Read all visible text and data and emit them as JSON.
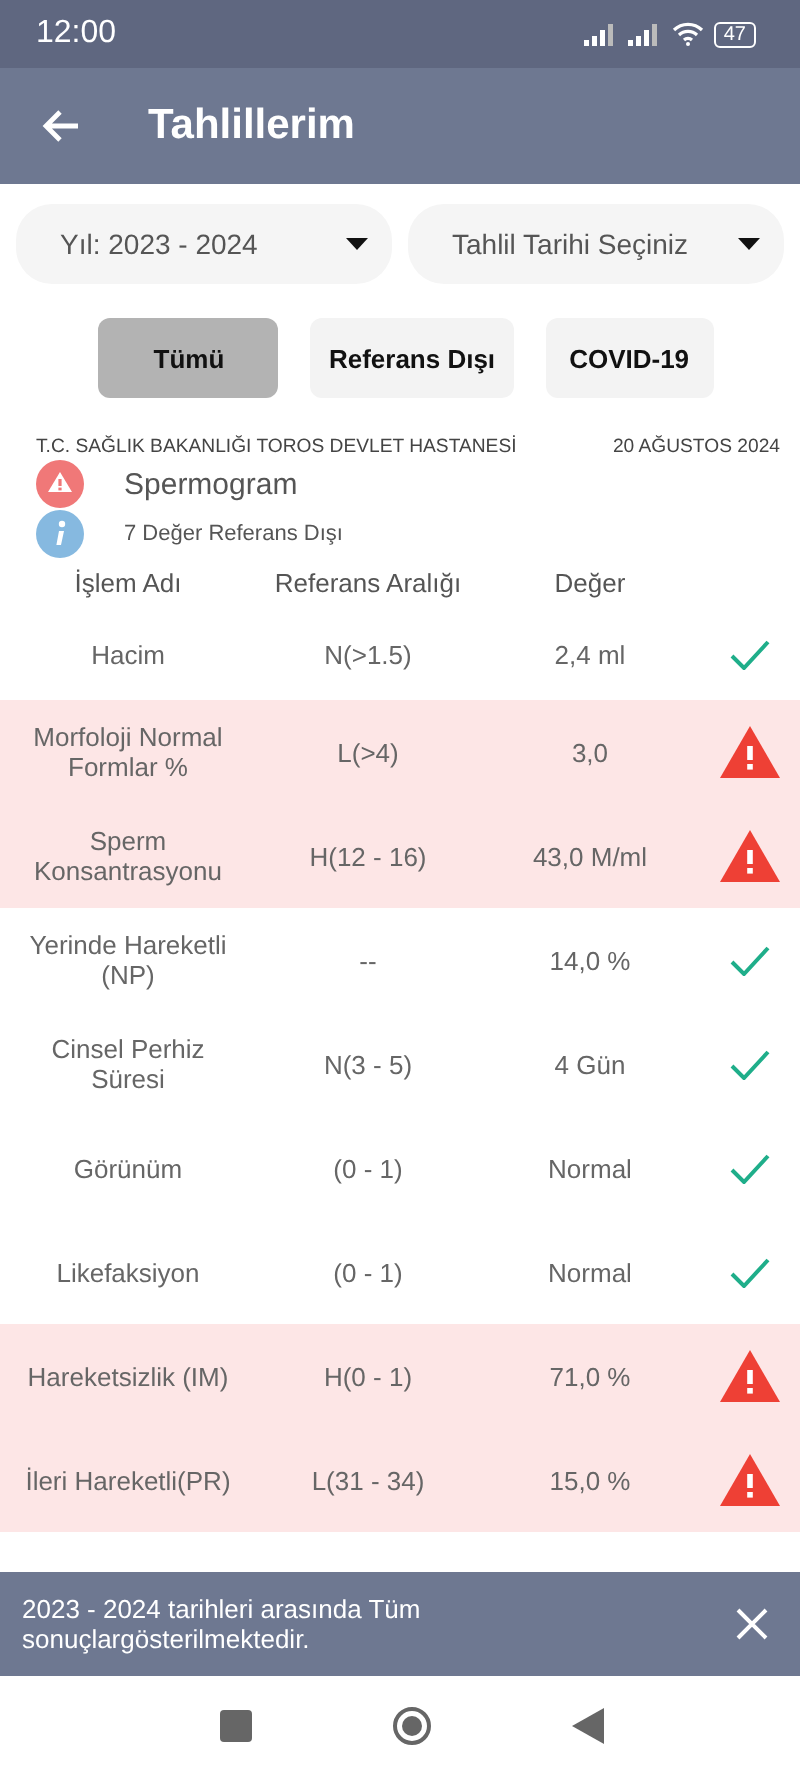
{
  "status_bar": {
    "time": "12:00",
    "battery": "47"
  },
  "app_bar": {
    "title": "Tahlillerim"
  },
  "dropdowns": [
    {
      "value": "Yıl: 2023 - 2024"
    },
    {
      "value": "Tahlil Tarihi Seçiniz"
    }
  ],
  "filters": [
    {
      "label": "Tümü",
      "selected": true
    },
    {
      "label": "Referans Dışı",
      "selected": false
    },
    {
      "label": "COVID-19",
      "selected": false
    }
  ],
  "report": {
    "hospital": "T.C. SAĞLIK BAKANLIĞI TOROS DEVLET HASTANESİ",
    "date": "20 AĞUSTOS 2024",
    "test_name": "Spermogram",
    "note": "7 Değer Referans Dışı"
  },
  "table": {
    "columns": [
      "İşlem Adı",
      "Referans Aralığı",
      "Değer"
    ],
    "rows": [
      {
        "name": "Hacim",
        "range": "N(>1.5)",
        "value": "2,4 ml",
        "out_of_range": false
      },
      {
        "name": "Morfoloji Normal Formlar %",
        "range": "L(>4)",
        "value": "3,0",
        "out_of_range": true
      },
      {
        "name": "Sperm Konsantrasyonu",
        "range": "H(12 - 16)",
        "value": "43,0 M/ml",
        "out_of_range": true
      },
      {
        "name": "Yerinde Hareketli (NP)",
        "range": "--",
        "value": "14,0 %",
        "out_of_range": false
      },
      {
        "name": "Cinsel Perhiz Süresi",
        "range": "N(3 - 5)",
        "value": "4 Gün",
        "out_of_range": false
      },
      {
        "name": "Görünüm",
        "range": "(0 - 1)",
        "value": "Normal",
        "out_of_range": false
      },
      {
        "name": "Likefaksiyon",
        "range": "(0 - 1)",
        "value": "Normal",
        "out_of_range": false
      },
      {
        "name": "Hareketsizlik (IM)",
        "range": "H(0 - 1)",
        "value": "71,0 %",
        "out_of_range": true
      },
      {
        "name": "İleri Hareketli(PR)",
        "range": "L(31 - 34)",
        "value": "15,0 %",
        "out_of_range": true
      }
    ]
  },
  "snackbar": {
    "message": "2023 - 2024 tarihleri arasında Tüm sonuçlargösterilmektedir."
  }
}
